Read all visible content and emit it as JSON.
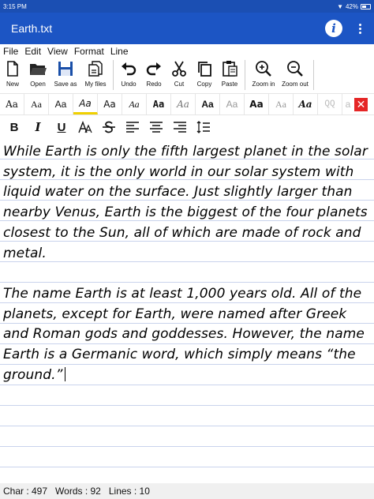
{
  "status_bar": {
    "time": "3:15 PM",
    "battery": "42%"
  },
  "app_bar": {
    "title": "Earth.txt"
  },
  "menu": [
    "File",
    "Edit",
    "View",
    "Format",
    "Line"
  ],
  "toolbar": {
    "new": "New",
    "open": "Open",
    "save_as": "Save as",
    "my_files": "My files",
    "undo": "Undo",
    "redo": "Redo",
    "cut": "Cut",
    "copy": "Copy",
    "paste": "Paste",
    "zoom_in": "Zoom in",
    "zoom_out": "Zoom out"
  },
  "font_samples": [
    "Aa",
    "Aa",
    "Aa",
    "Aa",
    "Aa",
    "Aa",
    "Aa",
    "Aa",
    "Aa",
    "Aa",
    "Aa",
    "Aa",
    "Aa",
    "QQ",
    "a"
  ],
  "format": {
    "bold": "B",
    "italic": "I",
    "underline": "U"
  },
  "document": {
    "paragraph1": "While Earth is only the fifth largest planet in the solar system, it is the only world in our solar system with liquid water on the surface. Just slightly larger than nearby Venus, Earth is the biggest of the four planets closest to the Sun, all of which are made of rock and metal.",
    "paragraph2": "The name Earth is at least 1,000 years old. All of the planets, except for Earth, were named after Greek and Roman gods and goddesses. However, the name Earth is a Germanic word, which simply means “the ground.”"
  },
  "stats": {
    "chars": "Char : 497",
    "words": "Words : 92",
    "lines": "Lines : 10"
  },
  "colors": {
    "app_bar": "#1c55c4",
    "status_bar": "#1b4fb3",
    "close": "#e52626",
    "selected": "#f0d000"
  }
}
